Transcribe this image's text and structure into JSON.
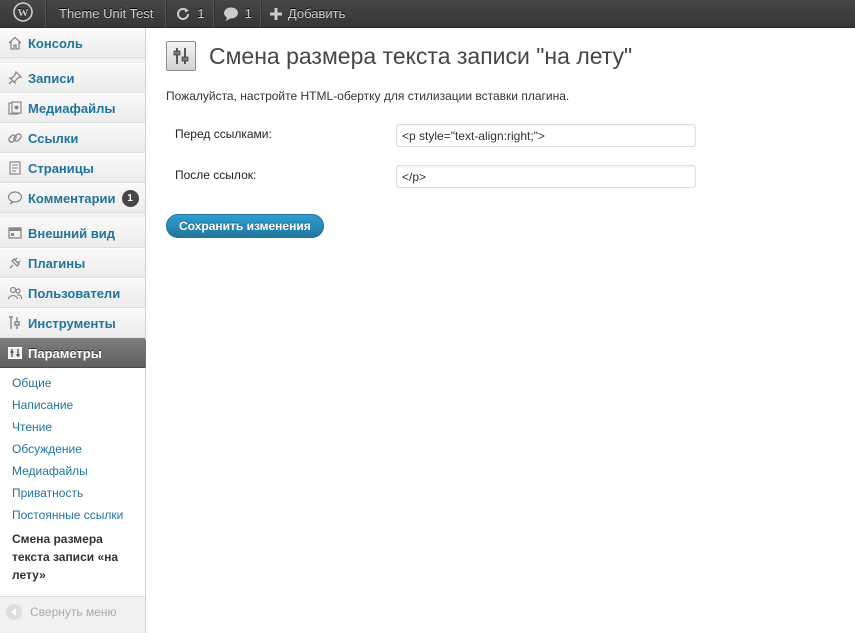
{
  "adminbar": {
    "wp_logo_icon": "wordpress-logo-icon",
    "site_name": "Theme Unit Test",
    "updates_count": "1",
    "comments_count": "1",
    "add_new_label": "Добавить"
  },
  "sidebar": {
    "items": [
      {
        "label": "Консоль",
        "icon": "home-icon"
      },
      {
        "label": "Записи",
        "icon": "pin-icon"
      },
      {
        "label": "Медиафайлы",
        "icon": "media-icon"
      },
      {
        "label": "Ссылки",
        "icon": "link-icon"
      },
      {
        "label": "Страницы",
        "icon": "page-icon"
      },
      {
        "label": "Комментарии",
        "icon": "comment-icon",
        "badge": "1"
      },
      {
        "label": "Внешний вид",
        "icon": "appearance-icon"
      },
      {
        "label": "Плагины",
        "icon": "plugin-icon"
      },
      {
        "label": "Пользователи",
        "icon": "users-icon"
      },
      {
        "label": "Инструменты",
        "icon": "tools-icon"
      },
      {
        "label": "Параметры",
        "icon": "settings-icon"
      }
    ],
    "submenu": [
      "Общие",
      "Написание",
      "Чтение",
      "Обсуждение",
      "Медиафайлы",
      "Приватность",
      "Постоянные ссылки",
      "Смена размера текста записи «на лету»"
    ],
    "collapse_label": "Свернуть меню"
  },
  "main": {
    "title": "Смена размера текста записи \"на лету\"",
    "intro": "Пожалуйста, настройте HTML-обертку для стилизации вставки плагина.",
    "before_label": "Перед ссылками:",
    "before_value": "<p style=\"text-align:right;\">",
    "after_label": "После ссылок:",
    "after_value": "</p>",
    "save_label": "Сохранить изменения"
  },
  "colors": {
    "link": "#21759b",
    "adminbar": "#464646",
    "active_menu": "#6e6e6e",
    "button": "#21759b"
  }
}
